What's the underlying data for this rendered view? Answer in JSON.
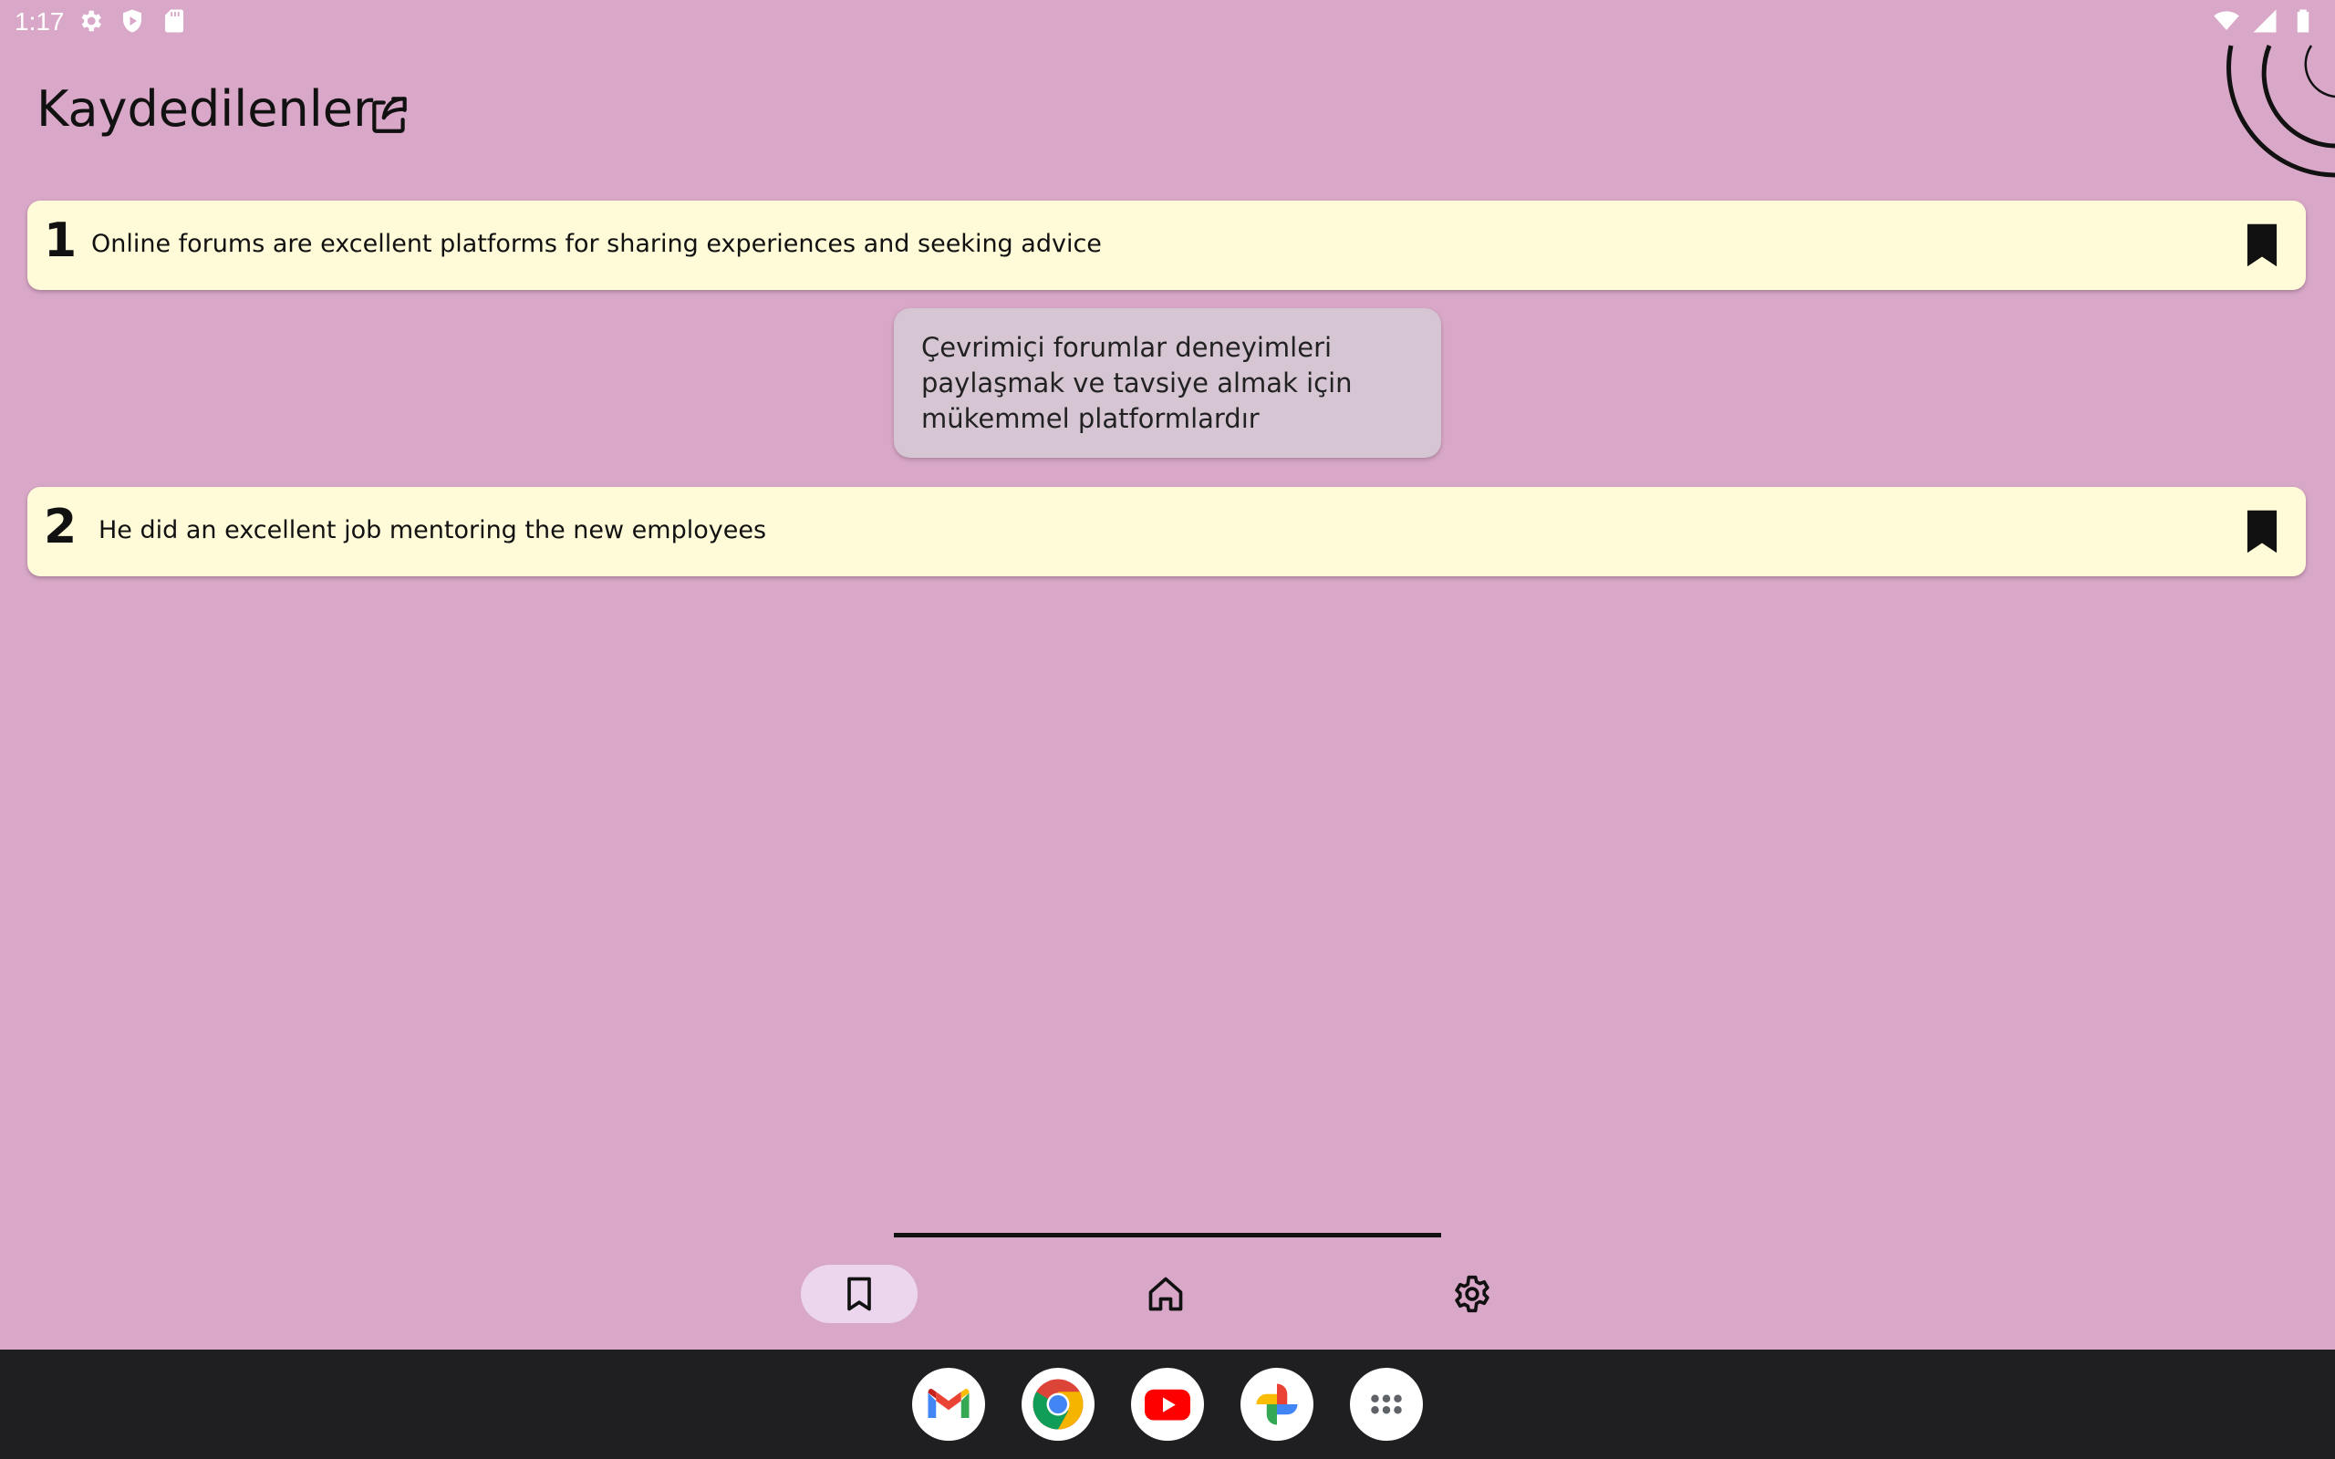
{
  "status_bar": {
    "time": "1:17",
    "left_icons": [
      "settings-gear-icon",
      "shield-icon",
      "sd-card-icon"
    ],
    "right_icons": [
      "wifi-icon",
      "cell-signal-icon",
      "battery-icon"
    ]
  },
  "header": {
    "title": "Kaydedilenler",
    "share_icon": "share-icon"
  },
  "saved_items": [
    {
      "number": "1",
      "text": "Online forums are excellent platforms for sharing experiences and seeking advice",
      "bookmarked": true
    },
    {
      "number": "2",
      "text": "He did an excellent job mentoring the new employees",
      "bookmarked": true
    }
  ],
  "translation_popup": {
    "text": "Çevrimiçi forumlar deneyimleri paylaşmak ve tavsiye almak için mükemmel platformlardır"
  },
  "bottom_nav": {
    "items": [
      {
        "icon": "bookmark-icon",
        "active": true
      },
      {
        "icon": "home-icon",
        "active": false
      },
      {
        "icon": "settings-icon",
        "active": false
      }
    ]
  },
  "dock": {
    "apps": [
      "gmail-icon",
      "chrome-icon",
      "youtube-icon",
      "photos-icon",
      "app-drawer-icon"
    ]
  },
  "colors": {
    "background": "#d9a7c7",
    "card": "#fffbd9",
    "popup": "#d6c6d4",
    "active_nav": "#ecd6ee",
    "dock": "#1f1f22"
  }
}
